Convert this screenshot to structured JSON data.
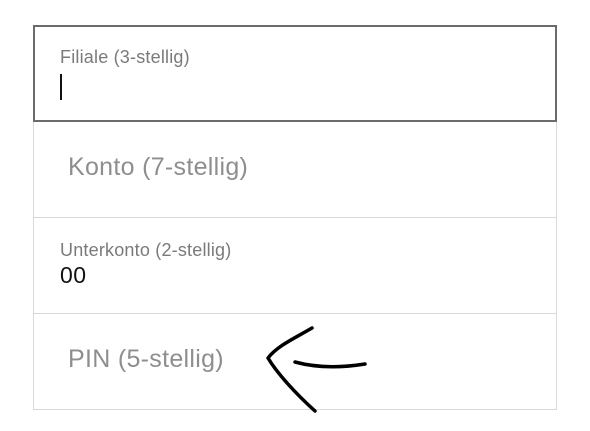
{
  "form": {
    "branch": {
      "label": "Filiale (3-stellig)",
      "value": ""
    },
    "account": {
      "placeholder": "Konto (7-stellig)"
    },
    "subaccount": {
      "label": "Unterkonto (2-stellig)",
      "value": "00"
    },
    "pin": {
      "placeholder": "PIN (5-stellig)"
    }
  },
  "annotation": {
    "icon": "hand-drawn-arrow-left-icon",
    "color": "#000000"
  },
  "colors": {
    "focused_border": "#6b6b6b",
    "border": "#d9d9d9",
    "label": "#7a7a7a",
    "placeholder": "#8e8e8e",
    "text": "#111111"
  }
}
